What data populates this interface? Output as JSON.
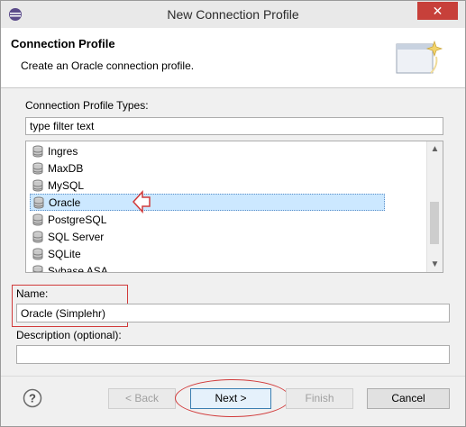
{
  "window": {
    "title": "New Connection Profile",
    "close_glyph": "✕"
  },
  "header": {
    "title": "Connection Profile",
    "description": "Create an Oracle connection profile."
  },
  "types": {
    "label": "Connection Profile Types:",
    "filter_value": "type filter text",
    "items": [
      "Ingres",
      "MaxDB",
      "MySQL",
      "Oracle",
      "PostgreSQL",
      "SQL Server",
      "SQLite",
      "Sybase ASA"
    ],
    "selected": "Oracle"
  },
  "name": {
    "label": "Name:",
    "value": "Oracle (Simplehr)"
  },
  "description": {
    "label": "Description (optional):",
    "value": ""
  },
  "buttons": {
    "back": "< Back",
    "next": "Next >",
    "finish": "Finish",
    "cancel": "Cancel"
  },
  "colors": {
    "annotation": "#d13a3a",
    "selection": "#cce8ff",
    "close": "#c7403a"
  }
}
